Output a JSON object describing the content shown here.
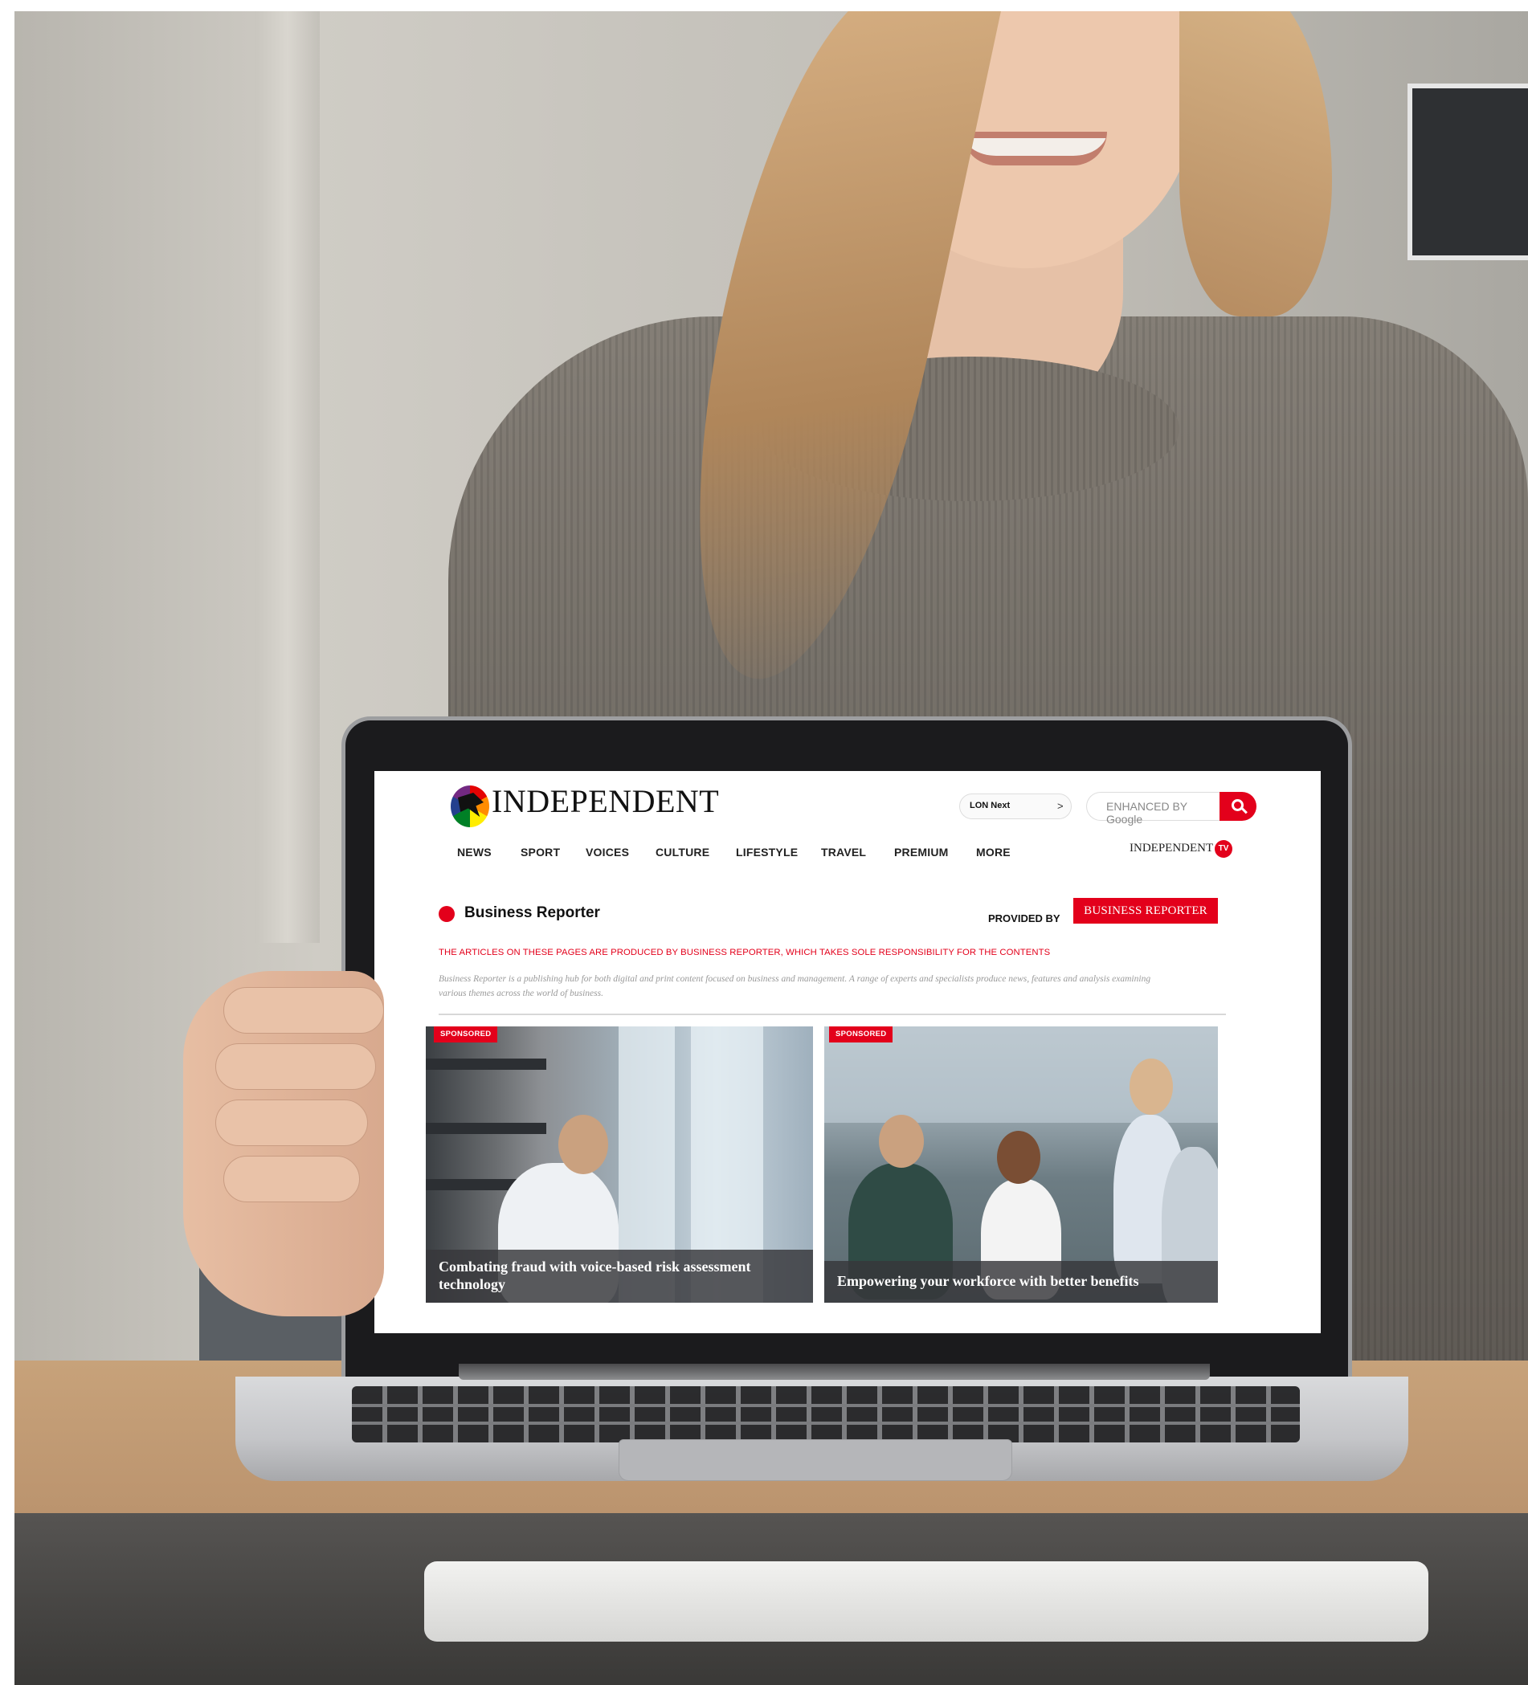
{
  "site": {
    "logo_text": "INDEPENDENT",
    "event_pill": "LON Next",
    "event_arrow": ">",
    "search_placeholder": "ENHANCED BY Google",
    "tv_logo": "INDEPENDENT",
    "tv_badge": "TV"
  },
  "nav": {
    "items": [
      {
        "label": "NEWS"
      },
      {
        "label": "SPORT"
      },
      {
        "label": "VOICES"
      },
      {
        "label": "CULTURE"
      },
      {
        "label": "LIFESTYLE"
      },
      {
        "label": "TRAVEL"
      },
      {
        "label": "PREMIUM"
      },
      {
        "label": "MORE"
      }
    ]
  },
  "section": {
    "title": "Business Reporter",
    "provided_by": "PROVIDED BY",
    "partner_logo": "BUSINESS REPORTER",
    "disclaimer": "THE ARTICLES ON THESE PAGES ARE PRODUCED BY BUSINESS REPORTER, WHICH TAKES SOLE RESPONSIBILITY FOR THE CONTENTS",
    "intro": "Business Reporter is a publishing hub for both digital and print content focused on business and management. A range of experts and specialists produce news, features and analysis examining various themes across the world of business."
  },
  "articles": [
    {
      "tag": "SPONSORED",
      "headline": "Combating fraud with voice-based risk assessment technology"
    },
    {
      "tag": "SPONSORED",
      "headline": "Empowering your workforce with better benefits"
    }
  ],
  "colors": {
    "brand_red": "#e3001b",
    "sweater": "#7a746c",
    "table_wood": "#c29d74",
    "laptop_silver": "#c4c5c8"
  }
}
